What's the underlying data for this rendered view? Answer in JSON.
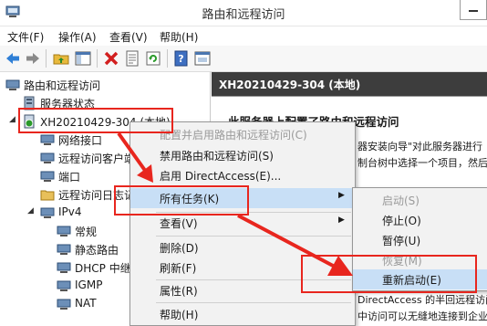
{
  "window": {
    "title": "路由和远程访问"
  },
  "menubar": {
    "file": "文件(F)",
    "action": "操作(A)",
    "view": "查看(V)",
    "help": "帮助(H)"
  },
  "tree": {
    "root": "路由和远程访问",
    "server_status": "服务器状态",
    "server": "XH20210429-304 (本地)",
    "network_interfaces": "网络接口",
    "remote_clients": "远程访问客户端",
    "ports": "端口",
    "remote_log": "远程访问日志记录",
    "ipv4": "IPv4",
    "general": "常规",
    "static_routes": "静态路由",
    "dhcp": "DHCP 中继",
    "igmp": "IGMP",
    "nat": "NAT"
  },
  "right_panel": {
    "header": "XH20210429-304 (本地)",
    "heading": "此服务器上配置了路由和远程访问",
    "line1": "器安装向导\"对此服务器进行",
    "line2": "制台树中选择一个项目，然后",
    "line3": "DirectAccess 的半回远程访问",
    "line4": "中访问可以无缝地连接到企业网"
  },
  "context_menu": {
    "configure": "配置并启用路由和远程访问(C)",
    "disable": "禁用路由和远程访问(S)",
    "enable_da": "启用 DirectAccess(E)...",
    "all_tasks": "所有任务(K)",
    "view": "查看(V)",
    "delete": "删除(D)",
    "refresh": "刷新(F)",
    "properties": "属性(R)",
    "help": "帮助(H)"
  },
  "submenu": {
    "start": "启动(S)",
    "stop": "停止(O)",
    "pause": "暂停(U)",
    "resume": "恢复(M)",
    "restart": "重新启动(E)"
  },
  "colors": {
    "annotation_red": "#e8261e",
    "highlight": "#c8dff6",
    "header_dark": "#3d3d3d"
  }
}
